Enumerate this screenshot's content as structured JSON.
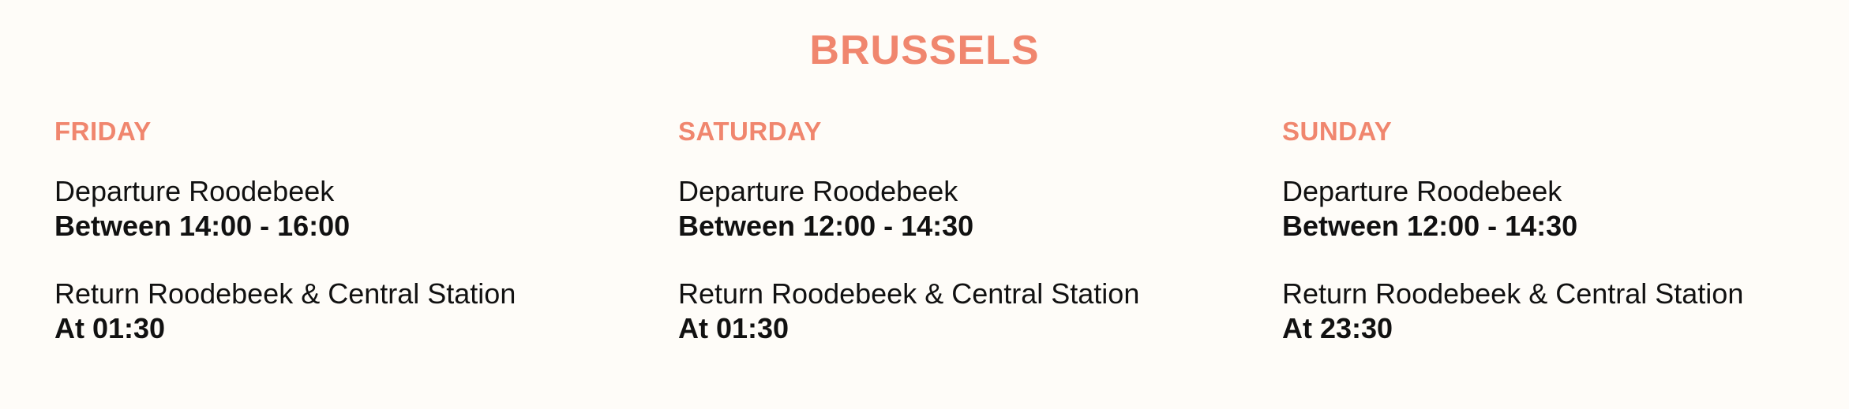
{
  "page": {
    "title": "BRUSSELS",
    "accent_color": "#f0866e",
    "background_color": "#fefcf8"
  },
  "days": [
    {
      "label": "FRIDAY",
      "departure_label": "Departure Roodebeek",
      "departure_time": "Between 14:00 - 16:00",
      "return_label": "Return Roodebeek & Central Station",
      "return_time": "At 01:30"
    },
    {
      "label": "SATURDAY",
      "departure_label": "Departure Roodebeek",
      "departure_time": "Between 12:00 - 14:30",
      "return_label": "Return Roodebeek & Central Station",
      "return_time": "At 01:30"
    },
    {
      "label": "SUNDAY",
      "departure_label": "Departure Roodebeek",
      "departure_time": "Between 12:00 - 14:30",
      "return_label": "Return Roodebeek & Central Station",
      "return_time": "At 23:30"
    }
  ]
}
